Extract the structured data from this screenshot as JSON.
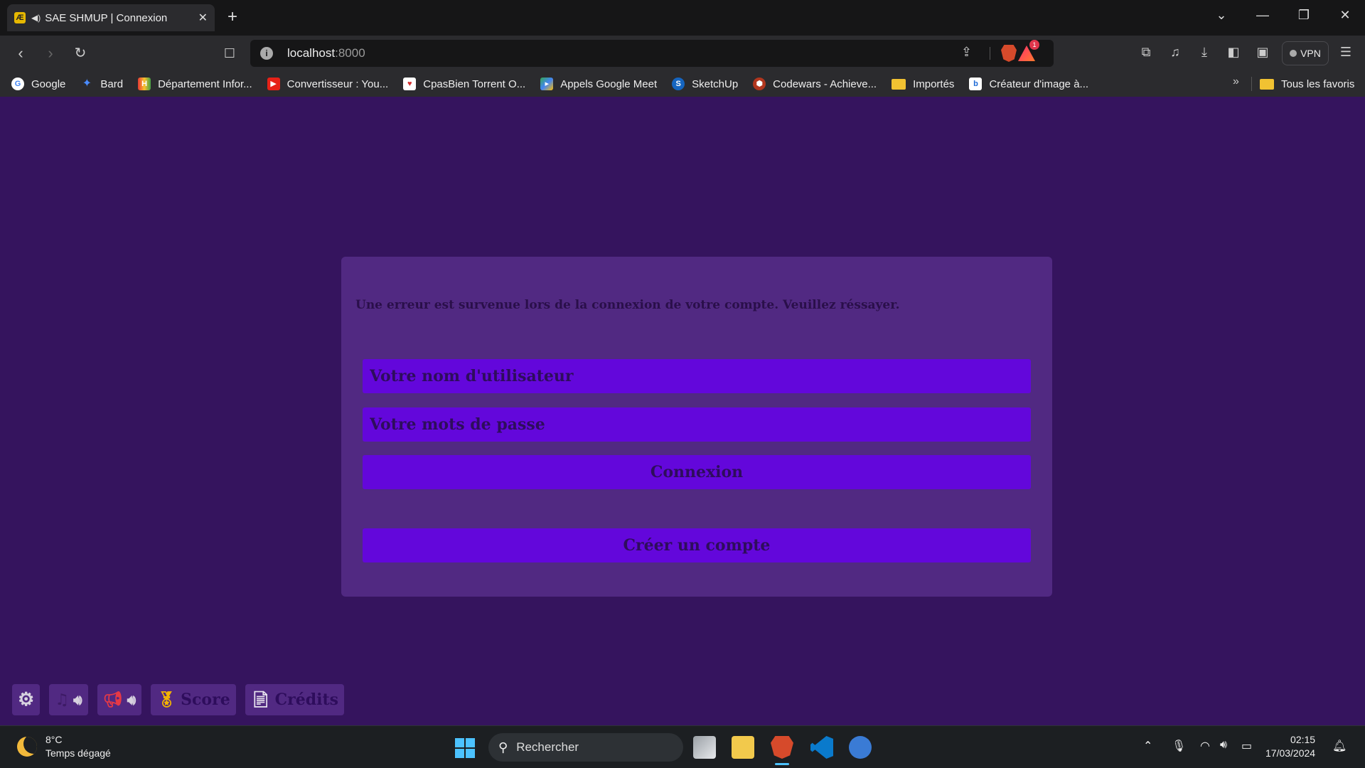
{
  "browser": {
    "tab_title": "SAE SHMUP | Connexion",
    "url_host": "localhost",
    "url_port": ":8000",
    "vpn_label": "VPN",
    "shields_badge": "1",
    "bookmarks": [
      {
        "label": "Google",
        "icon": "google-icon",
        "color": "#4285f4"
      },
      {
        "label": "Bard",
        "icon": "bard-icon",
        "color": "#4a8cff"
      },
      {
        "label": "Département Infor...",
        "icon": "iut-icon",
        "color": "#e53935"
      },
      {
        "label": "Convertisseur : You...",
        "icon": "youtube-icon",
        "color": "#e62117"
      },
      {
        "label": "CpasBien Torrent O...",
        "icon": "cpasbien-icon",
        "color": "#d32f2f"
      },
      {
        "label": "Appels Google Meet",
        "icon": "meet-icon",
        "color": "#00897b"
      },
      {
        "label": "SketchUp",
        "icon": "sketchup-icon",
        "color": "#1565c0"
      },
      {
        "label": "Codewars - Achieve...",
        "icon": "codewars-icon",
        "color": "#b1361e"
      },
      {
        "label": "Importés",
        "icon": "folder-icon",
        "color": "#f1c232"
      },
      {
        "label": "Créateur d'image à...",
        "icon": "bing-icon",
        "color": "#1e6bd6"
      }
    ],
    "bookmarks_more": "»",
    "all_favorites": "Tous les favoris"
  },
  "login": {
    "error_message": "Une erreur est survenue lors de la connexion de votre compte. Veuillez réssayer.",
    "username_placeholder": "Votre nom d'utilisateur",
    "password_placeholder": "Votre mots de passe",
    "login_button": "Connexion",
    "create_account_button": "Créer un compte"
  },
  "controls": {
    "score_label": "Score",
    "credits_label": "Crédits"
  },
  "taskbar": {
    "temperature": "8°C",
    "weather": "Temps dégagé",
    "search_label": "Rechercher",
    "time": "02:15",
    "date": "17/03/2024"
  },
  "colors": {
    "page_bg": "#35145e",
    "card_bg": "#512982",
    "input_bg": "#6307db",
    "text_dark": "#2e0d5c"
  }
}
